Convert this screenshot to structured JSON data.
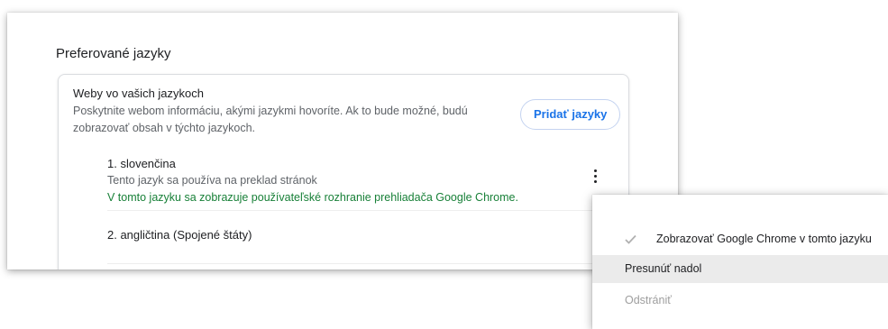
{
  "section": {
    "title": "Preferované jazyky"
  },
  "card": {
    "heading": "Weby vo vašich jazykoch",
    "description": "Poskytnite webom informáciu, akými jazykmi hovoríte. Ak to bude možné, budú zobrazovať obsah v týchto jazykoch.",
    "add_button": "Pridať jazyky"
  },
  "languages": [
    {
      "name": "1. slovenčina",
      "subtitle": "Tento jazyk sa používa na preklad stránok",
      "ui_note": "V tomto jazyku sa zobrazuje používateľské rozhranie prehliadača Google Chrome."
    },
    {
      "name": "2. angličtina (Spojené štáty)"
    }
  ],
  "menu": {
    "display_in_language": "Zobrazovať Google Chrome v tomto jazyku",
    "display_checked": true,
    "move_down": "Presunúť nadol",
    "remove": "Odstrániť"
  },
  "icons": {
    "more": "more-vert-icon",
    "check": "checkmark-icon"
  },
  "colors": {
    "accent": "#1a73e8",
    "ui_note": "#188038",
    "disabled": "#9e9e9e"
  }
}
